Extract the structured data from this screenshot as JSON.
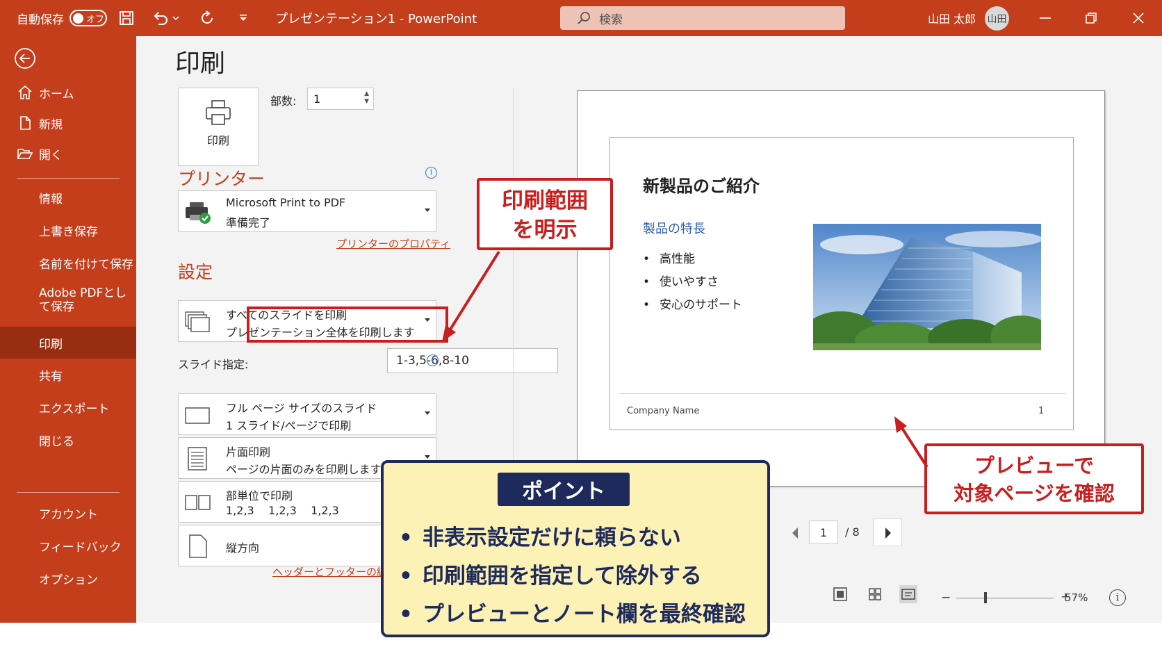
{
  "titlebar": {
    "autosave_label": "自動保存",
    "autosave_state": "オフ",
    "document_title": "プレゼンテーション1 - PowerPoint",
    "search_placeholder": "検索",
    "user_name": "山田 太郎",
    "avatar_initials": "山田"
  },
  "sidebar": {
    "items": [
      {
        "label": "ホーム"
      },
      {
        "label": "新規"
      },
      {
        "label": "開く"
      },
      {
        "label": "情報"
      },
      {
        "label": "上書き保存"
      },
      {
        "label": "名前を付けて保存"
      },
      {
        "label": "Adobe PDFとして保存"
      },
      {
        "label": "印刷",
        "selected": true
      },
      {
        "label": "共有"
      },
      {
        "label": "エクスポート"
      },
      {
        "label": "閉じる"
      },
      {
        "label": "アカウント"
      },
      {
        "label": "フィードバック"
      },
      {
        "label": "オプション"
      }
    ]
  },
  "print": {
    "page_title": "印刷",
    "print_button_label": "印刷",
    "copies_label": "部数:",
    "copies_value": "1",
    "printer_section": "プリンター",
    "printer_name": "Microsoft Print to PDF",
    "printer_status": "準備完了",
    "printer_properties_link": "プリンターのプロパティ",
    "settings_section": "設定",
    "range": {
      "title": "すべてのスライドを印刷",
      "desc": "プレゼンテーション全体を印刷します"
    },
    "slides_label": "スライド指定:",
    "slides_value": "1-3,5-6,8-10",
    "layout": {
      "title": "フル ページ サイズのスライド",
      "desc": "1 スライド/ページで印刷"
    },
    "sides": {
      "title": "片面印刷",
      "desc": "ページの片面のみを印刷します"
    },
    "collate": {
      "title": "部単位で印刷",
      "desc": "1,2,3    1,2,3    1,2,3"
    },
    "orientation": {
      "title": "縦方向"
    },
    "header_footer_link": "ヘッダーとフッターの編集"
  },
  "preview": {
    "slide_title": "新製品のご紹介",
    "slide_subtitle": "製品の特長",
    "bullets": [
      "高性能",
      "使いやすさ",
      "安心のサポート"
    ],
    "footer_company": "Company Name",
    "footer_page": "1",
    "current_page": "1",
    "total_pages": "/ 8",
    "zoom_percent": "57%"
  },
  "annotations": {
    "range_callout": [
      "印刷範囲",
      "を明示"
    ],
    "preview_callout": [
      "プレビューで",
      "対象ページを確認"
    ],
    "point_label": "ポイント",
    "point_items": [
      "非表示設定だけに頼らない",
      "印刷範囲を指定して除外する",
      "プレビューとノート欄を最終確認"
    ]
  },
  "colors": {
    "accent": "#c43e1c",
    "sidebar_selected": "#992d12",
    "callout_red": "#c81e1e",
    "point_bg": "#fdf2b5",
    "point_border": "#1d2a5b"
  }
}
